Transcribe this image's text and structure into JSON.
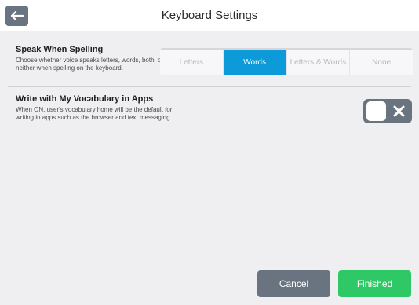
{
  "header": {
    "title": "Keyboard Settings",
    "back_icon": "arrow-left-icon"
  },
  "settings": {
    "spell": {
      "title": "Speak When Spelling",
      "description": "Choose whether voice speaks letters, words, both, or neither when spelling on the keyboard.",
      "options": [
        "Letters",
        "Words",
        "Letters & Words",
        "None"
      ],
      "selected": "Words"
    },
    "vocab": {
      "title": "Write with My Vocabulary in Apps",
      "description": "When ON, user's vocabulary home will be the default for writing in apps such as the browser and text messaging.",
      "toggle_state": "off",
      "toggle_icon": "close-icon"
    }
  },
  "footer": {
    "cancel_label": "Cancel",
    "finished_label": "Finished"
  },
  "colors": {
    "accent_blue": "#0d9ad9",
    "finished_green": "#2ec866",
    "neutral_gray": "#6a7480",
    "background": "#efeff2"
  }
}
